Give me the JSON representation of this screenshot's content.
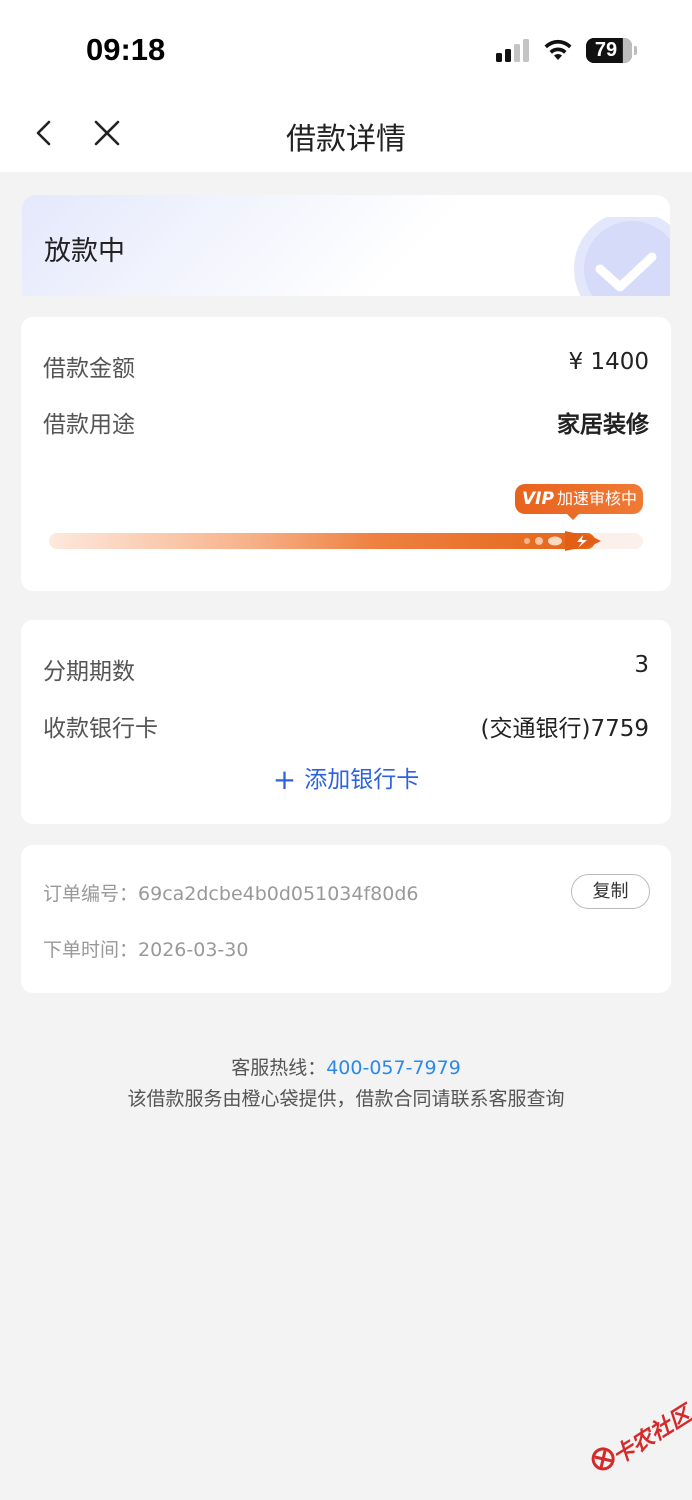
{
  "status_bar": {
    "time": "09:18",
    "battery": "79",
    "battery_level": 0.79
  },
  "nav": {
    "title": "借款详情",
    "back_icon": "chevron-left-icon",
    "close_icon": "close-icon"
  },
  "status_card": {
    "title": "放款中",
    "icon": "check-circle-icon"
  },
  "loan": {
    "amount_label": "借款金额",
    "amount_value": "¥ 1400",
    "purpose_label": "借款用途",
    "purpose_value": "家居装修",
    "vip_badge_vip": "VIP",
    "vip_badge_text": "加速审核中",
    "progress": 0.92
  },
  "repayment": {
    "installments_label": "分期期数",
    "installments_value": "3",
    "bank_label": "收款银行卡",
    "bank_value": "(交通银行)7759",
    "add_card_label": "添加银行卡"
  },
  "order": {
    "number_label": "订单编号：",
    "number_value": "69ca2dcbe4b0d051034f80d6",
    "copy_label": "复制",
    "time_label": "下单时间：",
    "time_value": "2026-03-30"
  },
  "footer": {
    "hotline_label": "客服热线：",
    "hotline_number": "400-057-7979",
    "note": "该借款服务由橙心袋提供，借款合同请联系客服查询"
  },
  "watermark": {
    "text": "卡农社区"
  },
  "colors": {
    "accent_blue": "#2f62e0",
    "link_blue": "#2b8ae8",
    "orange": "#e8621d"
  }
}
